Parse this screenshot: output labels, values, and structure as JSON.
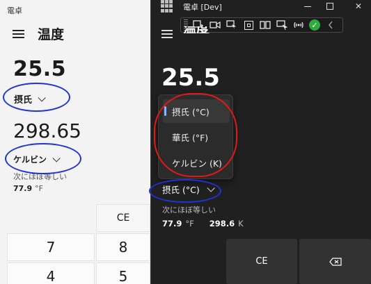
{
  "left_window": {
    "title": "電卓",
    "mode": "温度",
    "value_from": "25.5",
    "unit_from": "摂氏",
    "value_to": "298.65",
    "unit_to": "ケルビン",
    "approx_label": "次にほぼ等しい",
    "approx_value": "77.9",
    "approx_unit": "°F",
    "keys": [
      "CE",
      "7",
      "8",
      "4",
      "5"
    ]
  },
  "right_window": {
    "title": "電卓 [Dev]",
    "mode": "温度",
    "value": "25.5",
    "dropdown_options": [
      {
        "label": "摂氏 (°C)",
        "selected": true
      },
      {
        "label": "華氏 (°F)",
        "selected": false
      },
      {
        "label": "ケルビン (K)",
        "selected": false
      }
    ],
    "unit_from": "摂氏 (°C)",
    "approx_label": "次にほぼ等しい",
    "approx_value_1": "77.9",
    "approx_unit_1": "°F",
    "approx_value_2": "298.6",
    "approx_unit_2": "K",
    "key_ce": "CE",
    "window_close": "✕"
  },
  "colors": {
    "annotation_blue": "#1f34d6",
    "annotation_red": "#e01919",
    "dark_bg": "#202020",
    "light_bg": "#f3f3f3",
    "accent": "#8fb4ff"
  }
}
